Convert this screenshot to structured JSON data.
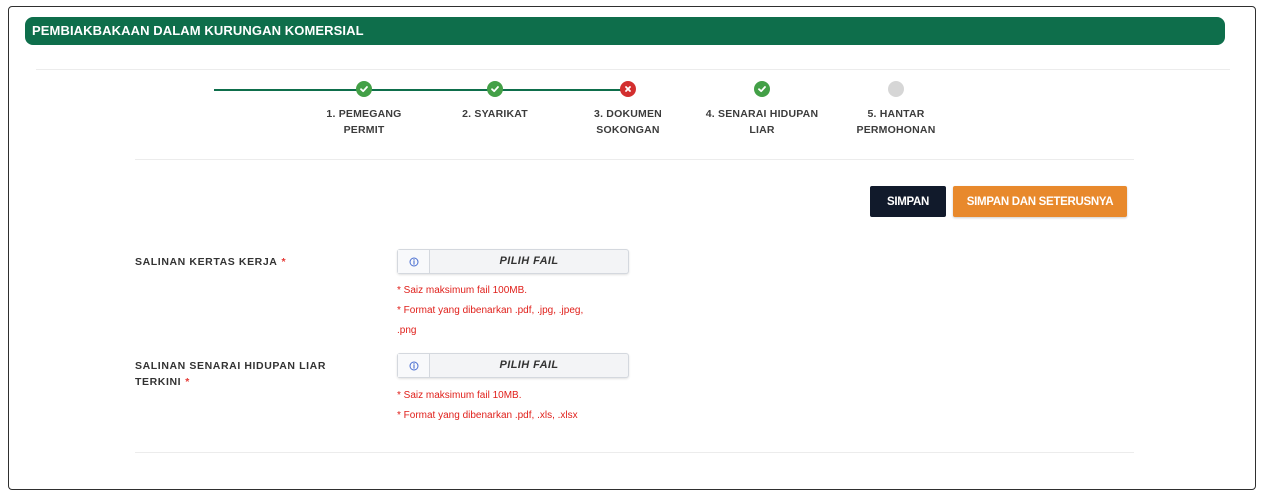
{
  "header": {
    "title": "PEMBIAKBAKAAN DALAM KURUNGAN KOMERSIAL"
  },
  "stepper": {
    "steps": [
      {
        "line1": "1. PEMEGANG",
        "line2": "PERMIT",
        "status": "done"
      },
      {
        "line1": "2. SYARIKAT",
        "line2": "",
        "status": "done"
      },
      {
        "line1": "3. DOKUMEN",
        "line2": "SOKONGAN",
        "status": "error"
      },
      {
        "line1": "4. SENARAI HIDUPAN",
        "line2": "LIAR",
        "status": "done"
      },
      {
        "line1": "5. HANTAR",
        "line2": "PERMOHONAN",
        "status": "pending"
      }
    ]
  },
  "toolbar": {
    "save_label": "SIMPAN",
    "save_next_label": "SIMPAN DAN SETERUSNYA"
  },
  "form": {
    "required_mark": "*",
    "kertas_kerja": {
      "label": "SALINAN KERTAS KERJA",
      "button": "PILIH FAIL",
      "hint1": "* Saiz maksimum fail 100MB.",
      "hint2": "* Format yang dibenarkan .pdf, .jpg, .jpeg,",
      "hint3": ".png"
    },
    "senarai_hidupan": {
      "label_line1": "SALINAN SENARAI HIDUPAN LIAR",
      "label_line2": "TERKINI",
      "button": "PILIH FAIL",
      "hint1": "* Saiz maksimum fail 10MB.",
      "hint2": "* Format yang dibenarkan .pdf, .xls, .xlsx"
    }
  },
  "colors": {
    "header_green": "#0e6e4b",
    "done_green": "#43a047",
    "error_red": "#d32f2f",
    "save_dark": "#111a2b",
    "save_next_orange": "#e8892c",
    "hint_red": "#e0201b"
  },
  "icons": {
    "done": "check-circle-icon",
    "error": "x-circle-icon",
    "pending": "empty-circle-icon",
    "file_info": "info-icon"
  }
}
